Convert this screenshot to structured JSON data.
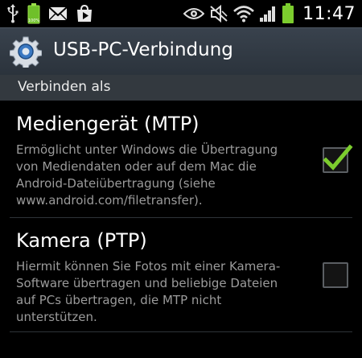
{
  "statusbar": {
    "left_icons": [
      "usb-icon",
      "battery-full-icon",
      "gmail-icon",
      "play-store-icon"
    ],
    "right_icons": [
      "eye-icon",
      "mute-icon",
      "wifi-icon",
      "signal-icon",
      "battery-icon"
    ],
    "time": "11:47"
  },
  "header": {
    "icon": "settings-gear-icon",
    "title": "USB-PC-Verbindung"
  },
  "section": {
    "title": "Verbinden als"
  },
  "options": [
    {
      "title": "Mediengerät (MTP)",
      "description_lines": [
        "Ermöglicht unter Windows die Übertragung",
        "von Mediendaten oder auf dem Mac die",
        "Android-Dateiübertragung (siehe",
        "www.android.com/filetransfer)."
      ],
      "checked": true
    },
    {
      "title": "Kamera (PTP)",
      "description_lines": [
        "Hiermit können Sie Fotos mit einer Kamera-",
        "Software übertragen und beliebige Dateien",
        "auf PCs übertragen, die MTP nicht",
        "unterstützen."
      ],
      "checked": false
    }
  ],
  "colors": {
    "accent_green": "#7ccd2e",
    "titlebar": "#323a44",
    "section_header": "#33393f",
    "description_text": "#9b9b9b"
  }
}
